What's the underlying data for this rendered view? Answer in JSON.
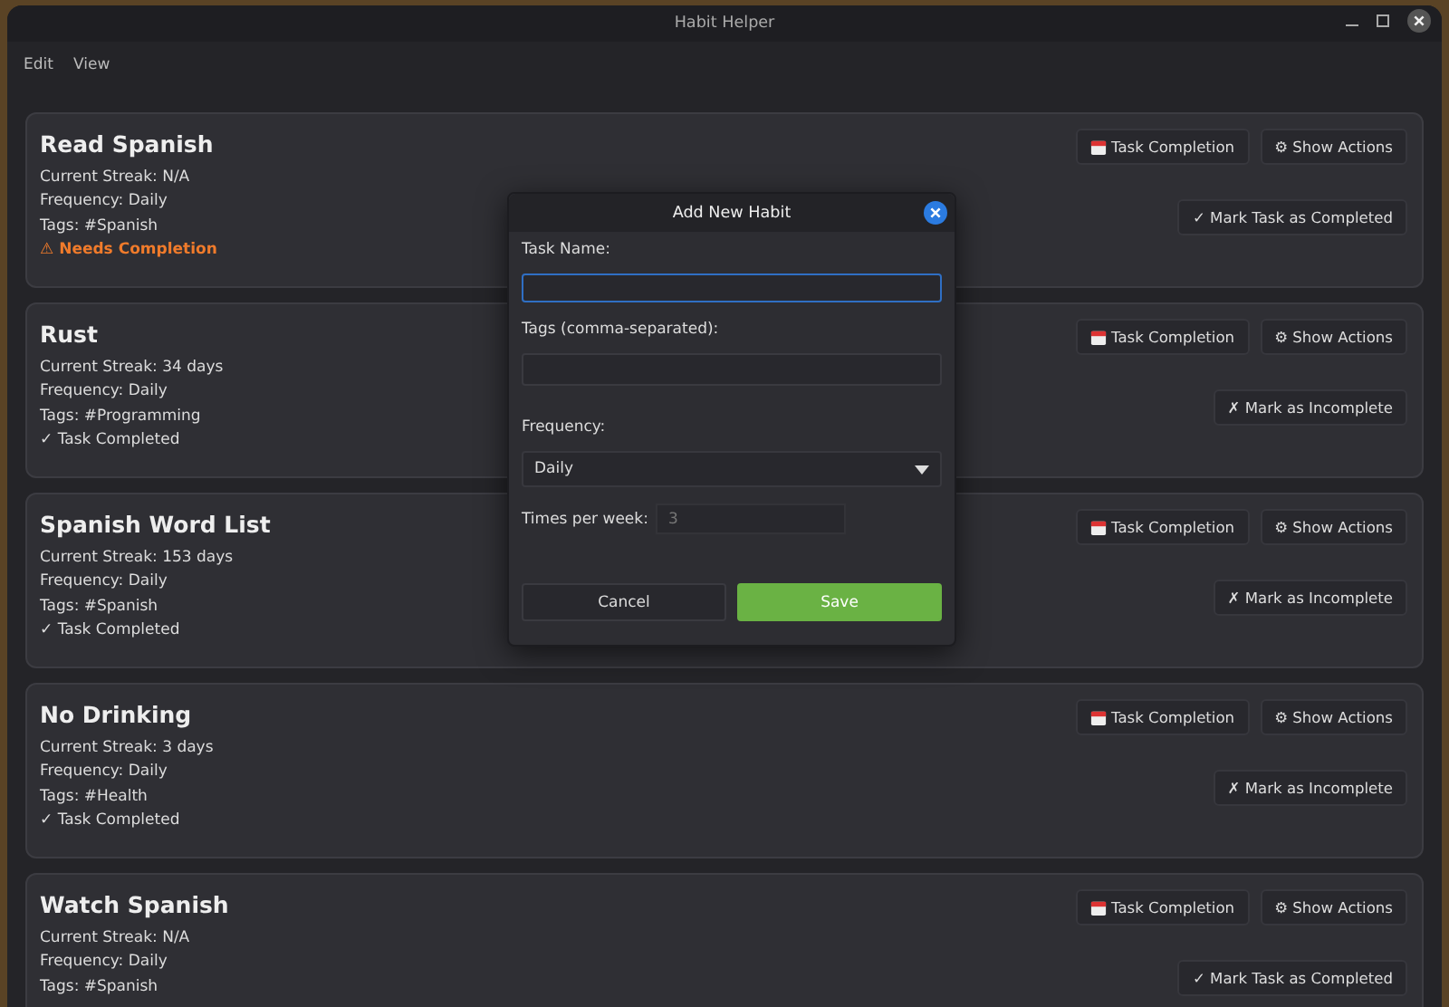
{
  "window": {
    "title": "Habit Helper"
  },
  "menu": [
    {
      "label": "Edit"
    },
    {
      "label": "View"
    }
  ],
  "habits": [
    {
      "name": "Read Spanish",
      "streak": "Current Streak: N/A",
      "frequency": "Frequency: Daily",
      "tags": "Tags:  #Spanish",
      "completed": false,
      "status": "⚠ Needs Completion",
      "calendar_button": "Task Completion",
      "actions_button": "⚙ Show Actions",
      "toggle_button": "✓ Mark Task as Completed"
    },
    {
      "name": "Rust",
      "streak": "Current Streak: 34 days",
      "frequency": "Frequency: Daily",
      "tags": "Tags:  #Programming",
      "completed": true,
      "status": "✓ Task Completed",
      "calendar_button": "Task Completion",
      "actions_button": "⚙ Show Actions",
      "toggle_button": "✗ Mark as Incomplete"
    },
    {
      "name": "Spanish Word List",
      "streak": "Current Streak: 153 days",
      "frequency": "Frequency: Daily",
      "tags": "Tags:  #Spanish",
      "completed": true,
      "status": "✓ Task Completed",
      "calendar_button": "Task Completion",
      "actions_button": "⚙ Show Actions",
      "toggle_button": "✗ Mark as Incomplete"
    },
    {
      "name": "No Drinking",
      "streak": "Current Streak: 3 days",
      "frequency": "Frequency: Daily",
      "tags": "Tags:  #Health",
      "completed": true,
      "status": "✓ Task Completed",
      "calendar_button": "Task Completion",
      "actions_button": "⚙ Show Actions",
      "toggle_button": "✗ Mark as Incomplete"
    },
    {
      "name": "Watch Spanish",
      "streak": "Current Streak: N/A",
      "frequency": "Frequency: Daily",
      "tags": "Tags:  #Spanish",
      "calendar_button": "Task Completion",
      "actions_button": "⚙ Show Actions",
      "toggle_button": "✓ Mark Task as Completed"
    }
  ],
  "dialog": {
    "title": "Add New Habit",
    "task_name_label": "Task Name:",
    "tags_label": "Tags (comma-separated):",
    "frequency_label": "Frequency:",
    "frequency_value": "Daily",
    "times_label": "Times per week:",
    "times_placeholder": "3",
    "cancel": "Cancel",
    "save": "Save"
  }
}
